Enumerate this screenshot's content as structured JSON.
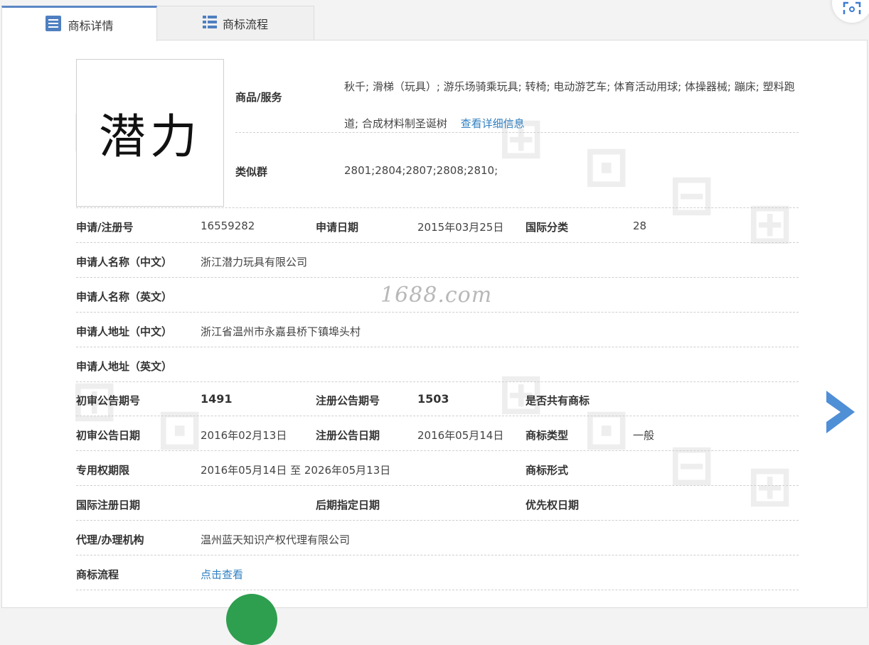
{
  "tabs": {
    "detail": "商标详情",
    "flow": "商标流程"
  },
  "logo": {
    "text": "潜力"
  },
  "watermark": {
    "site": "1688.com"
  },
  "goods": {
    "label": "商品/服务",
    "text": "秋千; 滑梯（玩具）; 游乐场骑乘玩具; 转椅; 电动游艺车; 体育活动用球; 体操器械; 蹦床; 塑料跑道; 合成材料制圣诞树",
    "more_link": "查看详细信息"
  },
  "similar": {
    "label": "类似群",
    "value": "2801;2804;2807;2808;2810;"
  },
  "fields": {
    "reg_no_label": "申请/注册号",
    "reg_no": "16559282",
    "apply_date_label": "申请日期",
    "apply_date": "2015年03月25日",
    "intl_class_label": "国际分类",
    "intl_class": "28",
    "applicant_cn_label": "申请人名称（中文）",
    "applicant_cn": "浙江潜力玩具有限公司",
    "applicant_en_label": "申请人名称（英文）",
    "address_cn_label": "申请人地址（中文）",
    "address_cn": "浙江省温州市永嘉县桥下镇埠头村",
    "address_en_label": "申请人地址（英文）",
    "prelim_no_label": "初审公告期号",
    "prelim_no": "1491",
    "reg_ann_no_label": "注册公告期号",
    "reg_ann_no": "1503",
    "shared_label": "是否共有商标",
    "prelim_date_label": "初审公告日期",
    "prelim_date": "2016年02月13日",
    "reg_ann_date_label": "注册公告日期",
    "reg_ann_date": "2016年05月14日",
    "mark_type_label": "商标类型",
    "mark_type": "一般",
    "term_label": "专用权期限",
    "term": "2016年05月14日 至 2026年05月13日",
    "mark_form_label": "商标形式",
    "intl_reg_date_label": "国际注册日期",
    "later_designation_label": "后期指定日期",
    "priority_date_label": "优先权日期",
    "agent_label": "代理/办理机构",
    "agent": "温州蓝天知识产权代理有限公司",
    "flow_label": "商标流程",
    "flow_link": "点击查看"
  },
  "colors": {
    "accent": "#5b87c5",
    "link": "#2f7fc1",
    "arrow": "#4f8fd6"
  }
}
